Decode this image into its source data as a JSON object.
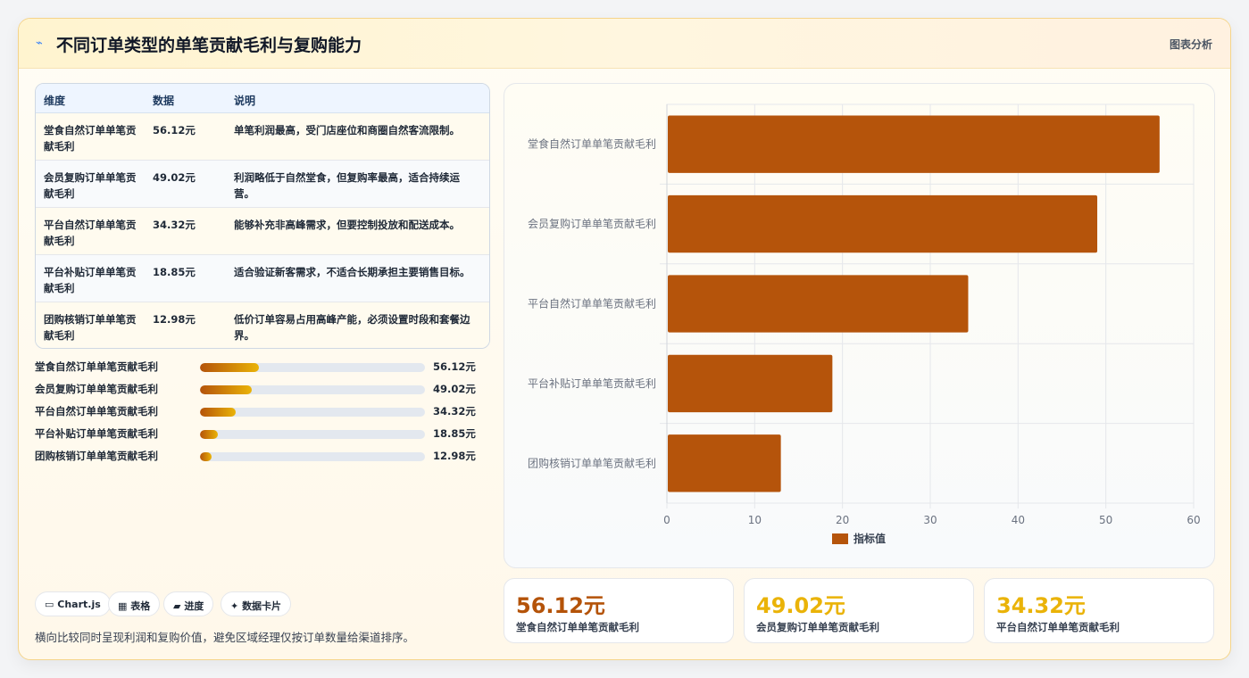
{
  "header": {
    "icon": "line-chart-icon",
    "title": "不同订单类型的单笔贡献毛利与复购能力",
    "tag": "图表分析"
  },
  "table": {
    "headers": [
      "维度",
      "数据",
      "说明"
    ],
    "rows": [
      {
        "dim": "堂食自然订单单笔贡献毛利",
        "value": "56.12元",
        "desc": "单笔利润最高，受门店座位和商圈自然客流限制。"
      },
      {
        "dim": "会员复购订单单笔贡献毛利",
        "value": "49.02元",
        "desc": "利润略低于自然堂食，但复购率最高，适合持续运营。"
      },
      {
        "dim": "平台自然订单单笔贡献毛利",
        "value": "34.32元",
        "desc": "能够补充非高峰需求，但要控制投放和配送成本。"
      },
      {
        "dim": "平台补贴订单单笔贡献毛利",
        "value": "18.85元",
        "desc": "适合验证新客需求，不适合长期承担主要销售目标。"
      },
      {
        "dim": "团购核销订单单笔贡献毛利",
        "value": "12.98元",
        "desc": "低价订单容易占用高峰产能，必须设置时段和套餐边界。"
      }
    ]
  },
  "progress": [
    {
      "label": "堂食自然订单单笔贡献毛利",
      "value": "56.12元",
      "pct": 26
    },
    {
      "label": "会员复购订单单笔贡献毛利",
      "value": "49.02元",
      "pct": 23
    },
    {
      "label": "平台自然订单单笔贡献毛利",
      "value": "34.32元",
      "pct": 16
    },
    {
      "label": "平台补贴订单单笔贡献毛利",
      "value": "18.85元",
      "pct": 8
    },
    {
      "label": "团购核销订单单笔贡献毛利",
      "value": "12.98元",
      "pct": 5
    }
  ],
  "pills": [
    {
      "icon": "window-icon",
      "glyph": "▭",
      "label": "Chart.js"
    },
    {
      "icon": "table-icon",
      "glyph": "▦",
      "label": "表格"
    },
    {
      "icon": "folder-icon",
      "glyph": "▰",
      "label": "进度"
    },
    {
      "icon": "sparkle-icon",
      "glyph": "✦",
      "label": "数据卡片"
    }
  ],
  "footer_note": "横向比较同时呈现利润和复购价值，避免区域经理仅按订单数量给渠道排序。",
  "stats": [
    {
      "value": "56.12元",
      "label": "堂食自然订单单笔贡献毛利",
      "color": "#b45309"
    },
    {
      "value": "49.02元",
      "label": "会员复购订单单笔贡献毛利",
      "color": "#eab308"
    },
    {
      "value": "34.32元",
      "label": "平台自然订单单笔贡献毛利",
      "color": "#eab308"
    }
  ],
  "colors": {
    "bar": "#b5540b",
    "accent": "#eab308"
  },
  "chart_data": {
    "type": "bar",
    "orientation": "horizontal",
    "categories": [
      "堂食自然订单单笔贡献毛利",
      "会员复购订单单笔贡献毛利",
      "平台自然订单单笔贡献毛利",
      "平台补贴订单单笔贡献毛利",
      "团购核销订单单笔贡献毛利"
    ],
    "series": [
      {
        "name": "指标值",
        "values": [
          56.12,
          49.02,
          34.32,
          18.85,
          12.98
        ]
      }
    ],
    "xlim": [
      0,
      60
    ],
    "xticks": [
      0,
      10,
      20,
      30,
      40,
      50,
      60
    ],
    "grid": true,
    "legend": "bottom"
  }
}
